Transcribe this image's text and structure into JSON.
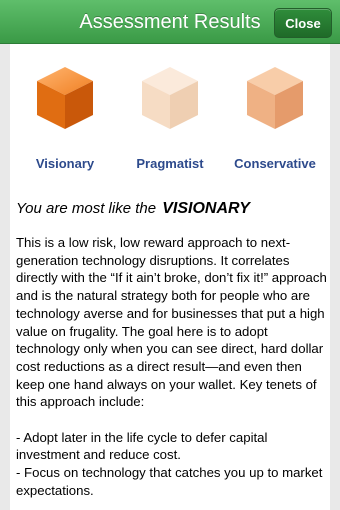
{
  "header": {
    "title": "Assessment Results",
    "close_label": "Close"
  },
  "profiles": [
    {
      "label": "Visionary",
      "selected": true,
      "color": "#e8741d"
    },
    {
      "label": "Pragmatist",
      "selected": false,
      "color": "#f7dcc3"
    },
    {
      "label": "Conservative",
      "selected": false,
      "color": "#efb08a"
    }
  ],
  "result": {
    "prefix": "You  are most like the",
    "type": "VISIONARY"
  },
  "description": "This is a low risk, low reward approach to next-generation technology disruptions.   It correlates directly with the “If it ain’t broke, don’t fix it!” approach and is the natural strategy both for people who are technology averse and for businesses that put a high value on frugality.  The goal here is to adopt technology only when you can see direct, hard dollar cost reductions as a direct result—and even then keep one hand always on your wallet.  Key tenets of this approach include:\n\n  - Adopt later in the life cycle to defer capital investment and reduce cost.\n  - Focus on technology that catches you up to market expectations."
}
